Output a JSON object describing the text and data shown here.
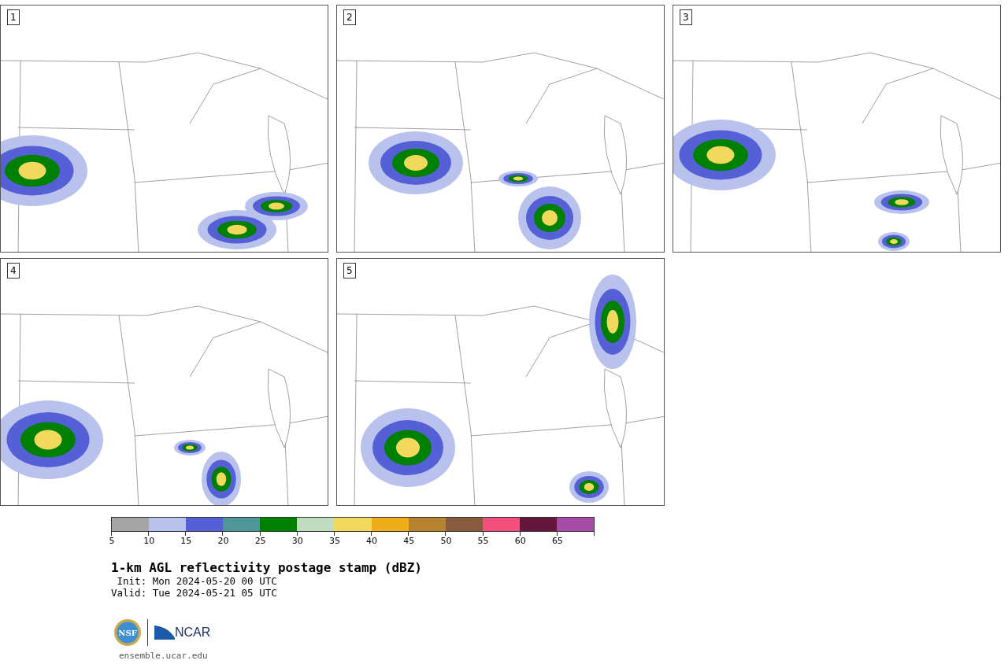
{
  "panels": [
    {
      "label": "1"
    },
    {
      "label": "2"
    },
    {
      "label": "3"
    },
    {
      "label": "4"
    },
    {
      "label": "5"
    }
  ],
  "colorbar": {
    "segments": [
      {
        "color": "#a5a5a5"
      },
      {
        "color": "#b8c2ec"
      },
      {
        "color": "#5560d6"
      },
      {
        "color": "#4f969b"
      },
      {
        "color": "#008000"
      },
      {
        "color": "#bfdcbf"
      },
      {
        "color": "#f0d95c"
      },
      {
        "color": "#efad1a"
      },
      {
        "color": "#b8832f"
      },
      {
        "color": "#8a5a3e"
      },
      {
        "color": "#f24f7c"
      },
      {
        "color": "#64173a"
      },
      {
        "color": "#a84ba6"
      }
    ],
    "ticks": [
      "5",
      "10",
      "15",
      "20",
      "25",
      "30",
      "35",
      "40",
      "45",
      "50",
      "55",
      "60",
      "65"
    ]
  },
  "title": "1-km AGL reflectivity postage stamp (dBZ)",
  "init": "Init: Mon 2024-05-20 00 UTC",
  "valid": "Valid: Tue 2024-05-21 05 UTC",
  "logo": {
    "seal": "NSF",
    "name": "NCAR"
  },
  "footer": "ensemble.ucar.edu"
}
